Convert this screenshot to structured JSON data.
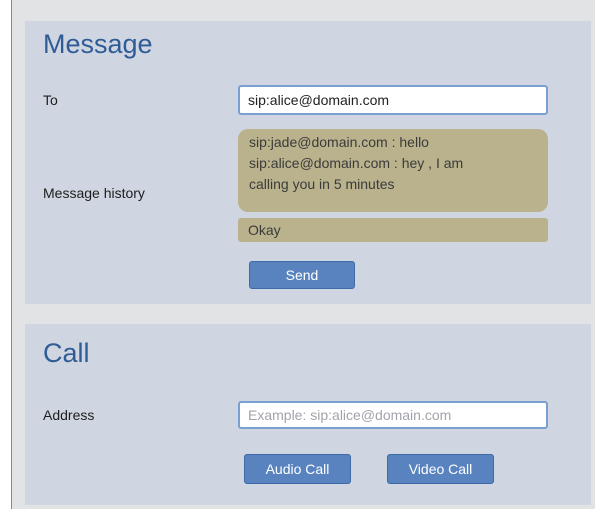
{
  "message": {
    "title": "Message",
    "to_label": "To",
    "to_value": "sip:alice@domain.com",
    "history_label": "Message history",
    "history": [
      {
        "line1": "sip:jade@domain.com  : hello",
        "line2": ""
      },
      {
        "line1": "sip:alice@domain.com : hey , I am",
        "line2": "calling you in 5 minutes"
      }
    ],
    "compose_text": "Okay",
    "send_label": "Send"
  },
  "call": {
    "title": "Call",
    "address_label": "Address",
    "address_placeholder": "Example: sip:alice@domain.com",
    "audio_label": "Audio Call",
    "video_label": "Video Call"
  },
  "colors": {
    "panel_bg": "#cfd6e1",
    "title": "#2f5b96",
    "history_bg": "#b9b28c",
    "button_bg": "#5883bf"
  }
}
